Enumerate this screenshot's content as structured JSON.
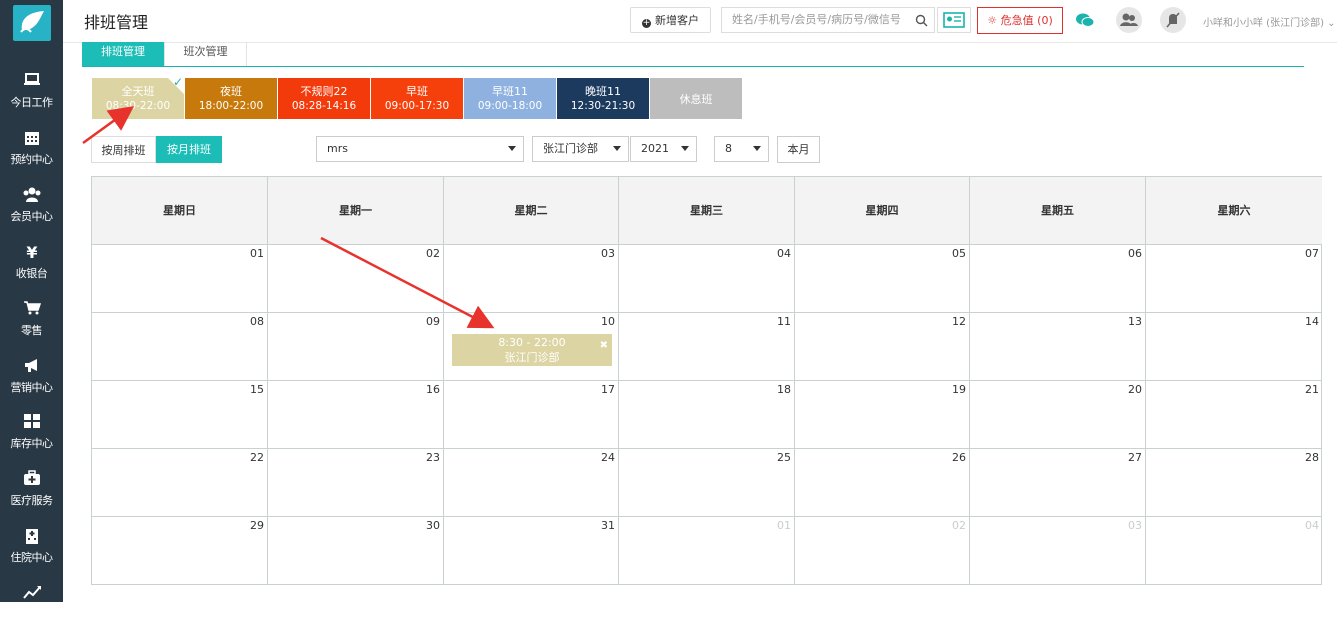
{
  "sidebar": {
    "items": [
      {
        "label": "今日工作",
        "icon": "laptop-icon"
      },
      {
        "label": "预约中心",
        "icon": "calendar-icon"
      },
      {
        "label": "会员中心",
        "icon": "users-icon"
      },
      {
        "label": "收银台",
        "icon": "yen-icon"
      },
      {
        "label": "零售",
        "icon": "cart-icon"
      },
      {
        "label": "营销中心",
        "icon": "megaphone-icon"
      },
      {
        "label": "库存中心",
        "icon": "grid-icon"
      },
      {
        "label": "医疗服务",
        "icon": "medkit-icon"
      },
      {
        "label": "住院中心",
        "icon": "hospital-icon"
      },
      {
        "label": "",
        "icon": "chart-icon"
      }
    ]
  },
  "header": {
    "title": "排班管理",
    "new_customer": "新增客户",
    "search_placeholder": "姓名/手机号/会员号/病历号/微信号",
    "danger_label": "危急值",
    "danger_count": "0",
    "user": "小咩和小小咩 (张江门诊部)"
  },
  "tabs": {
    "schedule": "排班管理",
    "shift_type": "班次管理"
  },
  "shifts": [
    {
      "name": "全天班",
      "time": "08:30-22:00",
      "color": "#dcd4a2",
      "selected": true
    },
    {
      "name": "夜班",
      "time": "18:00-22:00",
      "color": "#c8790c"
    },
    {
      "name": "不规则22",
      "time": "08:28-14:16",
      "color": "#f23a0b"
    },
    {
      "name": "早班",
      "time": "09:00-17:30",
      "color": "#f5400c"
    },
    {
      "name": "早班11",
      "time": "09:00-18:00",
      "color": "#8eb1df"
    },
    {
      "name": "晚班11",
      "time": "12:30-21:30",
      "color": "#1b3a5e"
    },
    {
      "name": "休息班",
      "time": "",
      "color": "#bdbdbd"
    }
  ],
  "controls": {
    "week_mode": "按周排班",
    "month_mode": "按月排班",
    "staff": "mrs",
    "clinic": "张江门诊部",
    "year": "2021",
    "month": "8",
    "this_month": "本月"
  },
  "calendar": {
    "weekdays": [
      "星期日",
      "星期一",
      "星期二",
      "星期三",
      "星期四",
      "星期五",
      "星期六"
    ],
    "weeks": [
      [
        "01",
        "02",
        "03",
        "04",
        "05",
        "06",
        "07"
      ],
      [
        "08",
        "09",
        "10",
        "11",
        "12",
        "13",
        "14"
      ],
      [
        "15",
        "16",
        "17",
        "18",
        "19",
        "20",
        "21"
      ],
      [
        "22",
        "23",
        "24",
        "25",
        "26",
        "27",
        "28"
      ],
      [
        "29",
        "30",
        "31",
        "01",
        "02",
        "03",
        "04"
      ]
    ],
    "event": {
      "time": "8:30 - 22:00",
      "location": "张江门诊部",
      "close": "✖"
    }
  }
}
